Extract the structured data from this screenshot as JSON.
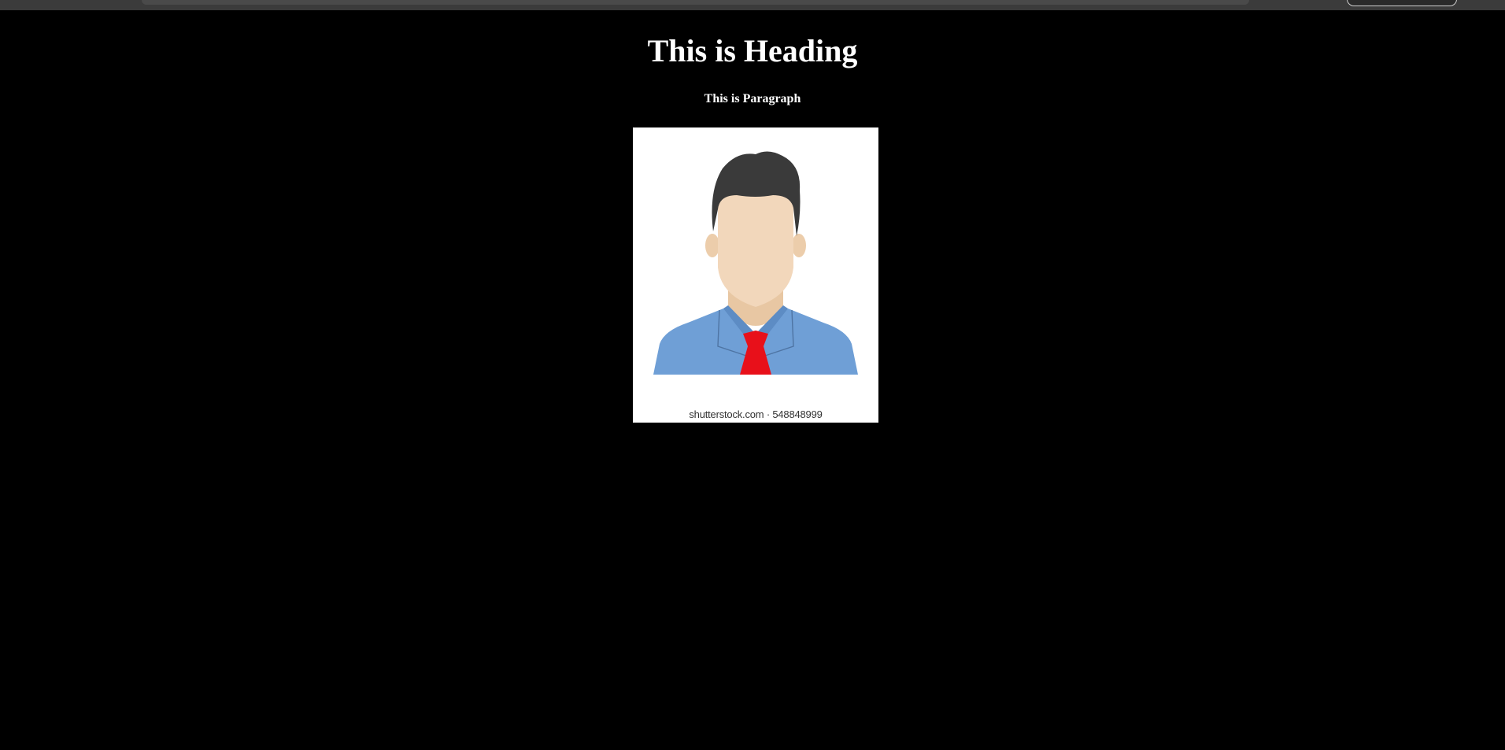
{
  "page": {
    "heading": "This is Heading",
    "paragraph": "This is Paragraph"
  },
  "image": {
    "watermark": "shutterstock.com · 548848999",
    "icon": "person-avatar-icon",
    "colors": {
      "hair": "#3a3a3a",
      "skin": "#f2d7bb",
      "neck": "#e8c7a3",
      "shirt": "#6f9fd6",
      "tie": "#e8101a"
    }
  },
  "colors": {
    "background": "#000000",
    "text": "#ffffff"
  }
}
